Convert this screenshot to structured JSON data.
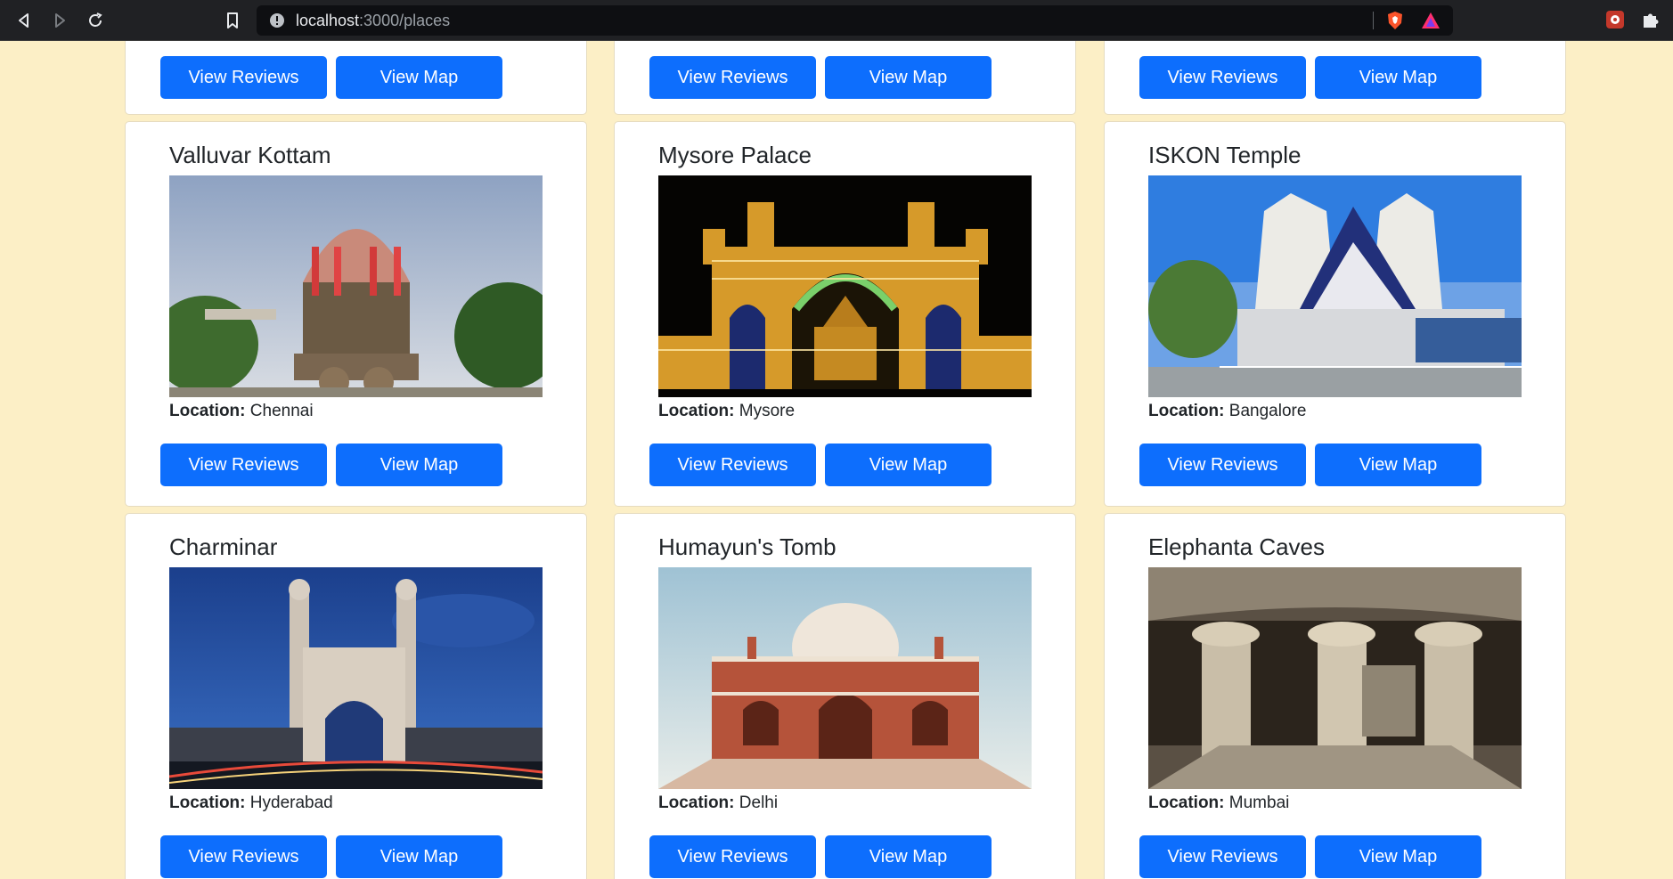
{
  "browser": {
    "url_host": "localhost",
    "url_path": ":3000/places"
  },
  "buttons": {
    "reviews": "View Reviews",
    "map": "View Map"
  },
  "location_label": "Location:",
  "places": [
    {
      "name": "Valluvar Kottam",
      "location": "Chennai",
      "image": "chariot-temple"
    },
    {
      "name": "Mysore Palace",
      "location": "Mysore",
      "image": "illuminated-palace"
    },
    {
      "name": "ISKON Temple",
      "location": "Bangalore",
      "image": "white-blue-temple"
    },
    {
      "name": "Charminar",
      "location": "Hyderabad",
      "image": "four-minaret-monument"
    },
    {
      "name": "Humayun's Tomb",
      "location": "Delhi",
      "image": "red-domed-tomb"
    },
    {
      "name": "Elephanta Caves",
      "location": "Mumbai",
      "image": "rock-cut-cave"
    }
  ]
}
